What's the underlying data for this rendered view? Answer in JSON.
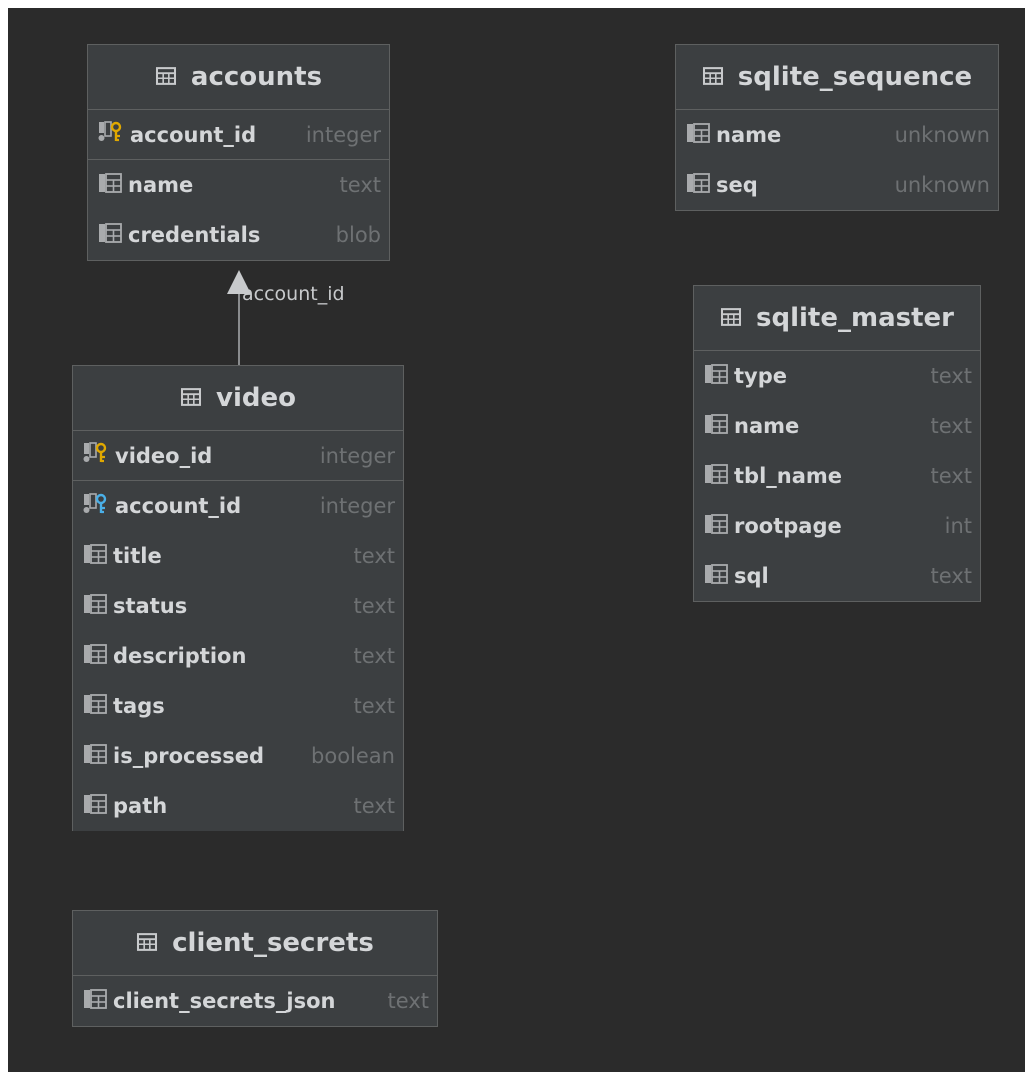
{
  "tables": {
    "accounts": {
      "title": "accounts",
      "columns": [
        {
          "name": "account_id",
          "type": "integer",
          "key": "pk"
        },
        {
          "name": "name",
          "type": "text"
        },
        {
          "name": "credentials",
          "type": "blob"
        }
      ]
    },
    "video": {
      "title": "video",
      "columns": [
        {
          "name": "video_id",
          "type": "integer",
          "key": "pk"
        },
        {
          "name": "account_id",
          "type": "integer",
          "key": "fk"
        },
        {
          "name": "title",
          "type": "text"
        },
        {
          "name": "status",
          "type": "text"
        },
        {
          "name": "description",
          "type": "text"
        },
        {
          "name": "tags",
          "type": "text"
        },
        {
          "name": "is_processed",
          "type": "boolean"
        },
        {
          "name": "path",
          "type": "text"
        }
      ]
    },
    "client_secrets": {
      "title": "client_secrets",
      "columns": [
        {
          "name": "client_secrets_json",
          "type": "text"
        }
      ]
    },
    "sqlite_sequence": {
      "title": "sqlite_sequence",
      "columns": [
        {
          "name": "name",
          "type": "unknown"
        },
        {
          "name": "seq",
          "type": "unknown"
        }
      ]
    },
    "sqlite_master": {
      "title": "sqlite_master",
      "columns": [
        {
          "name": "type",
          "type": "text"
        },
        {
          "name": "name",
          "type": "text"
        },
        {
          "name": "tbl_name",
          "type": "text"
        },
        {
          "name": "rootpage",
          "type": "int"
        },
        {
          "name": "sql",
          "type": "text"
        }
      ]
    }
  },
  "relations": [
    {
      "from": "video",
      "to": "accounts",
      "label": "account_id"
    }
  ],
  "colors": {
    "background": "#2b2b2b",
    "table_fill": "#3c3f41",
    "border": "#5e6060",
    "text": "#d4d6d8",
    "type_text": "#6e7173",
    "pk_key": "#e0a800",
    "fk_key": "#4ab0e8"
  }
}
